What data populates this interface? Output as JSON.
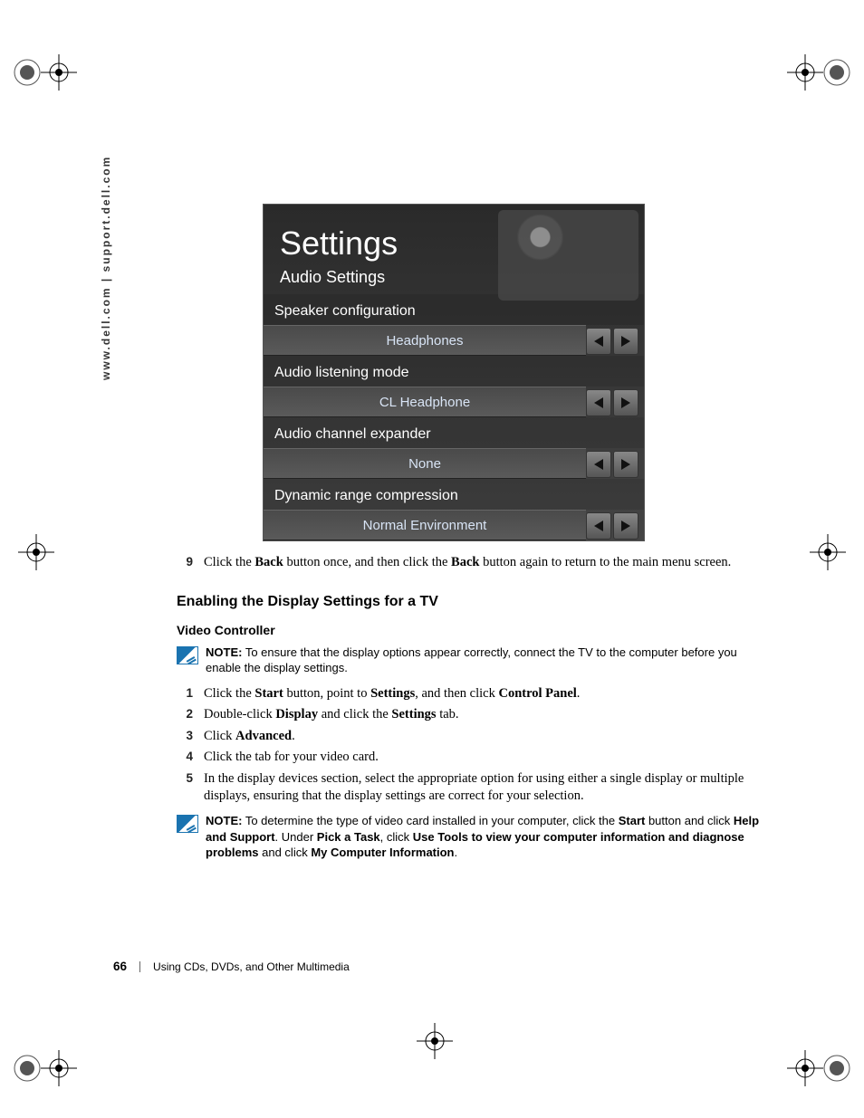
{
  "side_url": "www.dell.com | support.dell.com",
  "panel": {
    "title": "Settings",
    "subtitle": "Audio Settings",
    "items": [
      {
        "label": "Speaker configuration",
        "value": "Headphones"
      },
      {
        "label": "Audio listening mode",
        "value": "CL Headphone"
      },
      {
        "label": "Audio channel expander",
        "value": "None"
      },
      {
        "label": "Dynamic range compression",
        "value": "Normal Environment"
      }
    ]
  },
  "step9_full": "Click the Back button once, and then click the Back button again to return to the main menu screen.",
  "section_heading": "Enabling the Display Settings for a TV",
  "sub_heading": "Video Controller",
  "note1_full": "NOTE: To ensure that the display options appear correctly, connect the TV to the computer before you enable the display settings.",
  "steps": {
    "s1": "Click the Start button, point to Settings, and then click Control Panel.",
    "s2": "Double-click Display and click the Settings tab.",
    "s3": "Click Advanced.",
    "s4": "Click the tab for your video card.",
    "s5": "In the display devices section, select the appropriate option for using either a single display or multiple displays, ensuring that the display settings are correct for your selection."
  },
  "note2_full": "NOTE: To determine the type of video card installed in your computer, click the Start button and click Help and Support. Under Pick a Task, click Use Tools to view your computer information and diagnose problems and click My Computer Information.",
  "footer": {
    "page": "66",
    "chapter": "Using CDs, DVDs, and Other Multimedia"
  },
  "nums": {
    "n9": "9",
    "n1": "1",
    "n2": "2",
    "n3": "3",
    "n4": "4",
    "n5": "5"
  }
}
